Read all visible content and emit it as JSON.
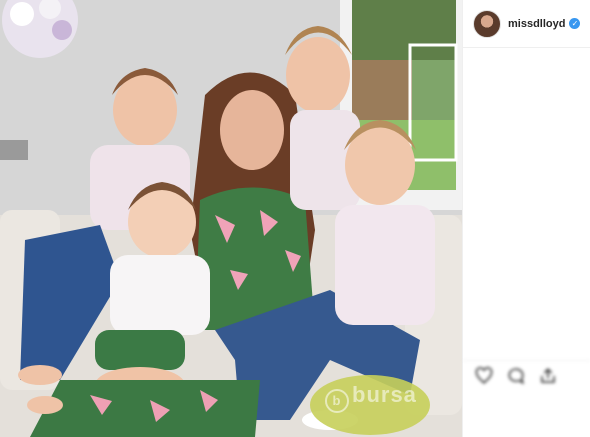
{
  "post": {
    "username": "missdlloyd",
    "verified_glyph": "✓",
    "photo_alt": "family portrait photo",
    "watermark_text": "bursa"
  },
  "icons": {
    "verified": "verified-badge-icon",
    "like": "heart-icon",
    "comment": "comment-icon",
    "share": "share-icon"
  },
  "colors": {
    "verified_blue": "#3897f0",
    "text_dark": "#262626",
    "border": "#efefef"
  }
}
